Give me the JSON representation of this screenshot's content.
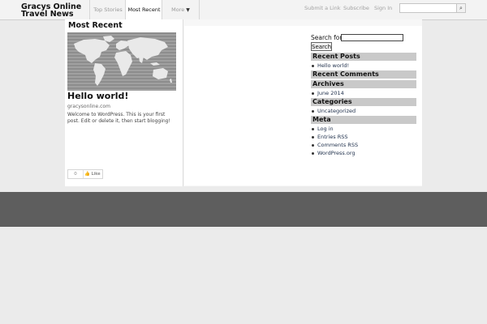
{
  "header": {
    "site_title": "Gracys Online Travel News",
    "tabs": [
      {
        "label": "Top Stories"
      },
      {
        "label": "Most Recent"
      },
      {
        "label": "More"
      }
    ],
    "links": {
      "submit": "Submit a Link",
      "subscribe": "Subscribe",
      "signin": "Sign In"
    },
    "search_placeholder": ""
  },
  "main": {
    "section_title": "Most Recent",
    "post": {
      "title": "Hello world!",
      "source": "gracysonline.com",
      "excerpt": "Welcome to WordPress. This is your first post. Edit or delete it, then start blogging!",
      "like_count": "0",
      "like_label": "Like"
    }
  },
  "sidebar": {
    "search_label": "Search for:",
    "search_button": "Search",
    "recent_posts_title": "Recent Posts",
    "recent_posts": [
      "Hello world!"
    ],
    "recent_comments_title": "Recent Comments",
    "archives_title": "Archives",
    "archives": [
      "June 2014"
    ],
    "categories_title": "Categories",
    "categories": [
      "Uncategorized"
    ],
    "meta_title": "Meta",
    "meta": [
      "Log in",
      "Entries RSS",
      "Comments RSS",
      "WordPress.org"
    ]
  },
  "icons": {
    "more_dropdown": "caret-down-icon",
    "search": "search-icon",
    "like": "thumbs-up-icon"
  }
}
